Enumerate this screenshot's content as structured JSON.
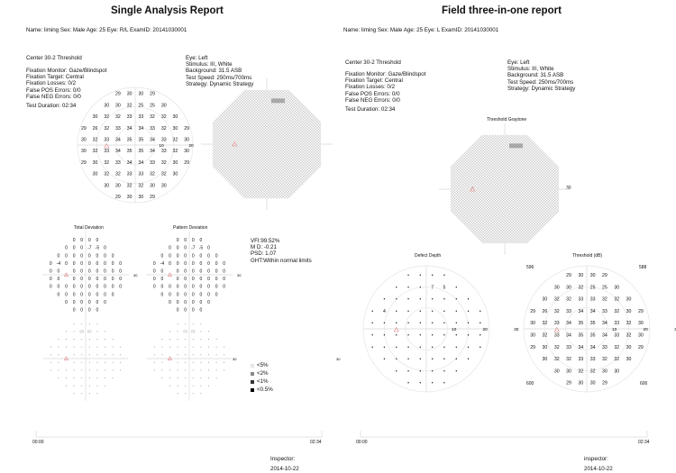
{
  "left": {
    "title": "Single Analysis Report",
    "patient": "Name: liming  Sex: Male  Age: 25  Eye: R/L  ExamID: 20141030001",
    "test_name": "Center 30-2 Threshold",
    "fixation": [
      "Fixation Monitor: Gaze/Blindspot",
      "Fixation Target: Central",
      "Fixation Losses: 0/2",
      "False POS Errors: 0/0",
      "False NEG Errors: 0/0"
    ],
    "duration": "Test Duration: 02:34",
    "params": [
      "Eye: Left",
      "Stimulus: III, White",
      "Background: 31.5 ASB",
      "Test Speed: 250ms/700ms",
      "Strategy: Dynamic Strategy"
    ],
    "axis_labels": [
      "10",
      "20",
      "30"
    ],
    "graytone_axis_label": "30",
    "total_deviation_title": "Total Deviation",
    "pattern_deviation_title": "Pattern Deviation",
    "deviation_axis_label": "30",
    "stats": [
      "VFI:99.52%",
      "M D: -0.21",
      "PSD: 1.07",
      "GHT:Within normal limits"
    ],
    "legend": [
      "<5%",
      "<2%",
      "<1%",
      "<0.5%"
    ],
    "timeline_start": "00:00",
    "timeline_end": "02:34",
    "inspector": "Inspector:",
    "date": "2014-10-22"
  },
  "right": {
    "title": "Field three-in-one report",
    "patient": "Name: liming  Sex: Male  Age: 25  Eye: L  ExamID: 20141030001",
    "test_name": "Center 30-2 Threshold",
    "fixation": [
      "Fixation Monitor: Gaze/Blindspot",
      "Fixation Target: Central",
      "Fixation Losses: 0/2",
      "False POS Errors: 0/0",
      "False NEG Errors: 0/0"
    ],
    "duration": "Test Duration: 02:34",
    "params": [
      "Eye: Left",
      "Stimulus: III, White",
      "Background: 31.5 ASB",
      "Test Speed: 250ms/700ms",
      "Strategy: Dynamic Strategy"
    ],
    "graytone_title": "Threshold Graytone",
    "graytone_axis_label": "30",
    "defect_depth_title": "Defect Depth",
    "threshold_title": "Threshold (dB)",
    "axis_labels": [
      "10",
      "20",
      "30"
    ],
    "corner_labels": [
      "596",
      "588",
      "600",
      "600"
    ],
    "timeline_start": "00:00",
    "timeline_end": "02:34",
    "inspector": "inspector:",
    "date": "2014-10-22"
  },
  "threshold_values": [
    [
      "29",
      "30",
      "30",
      "29"
    ],
    [
      "30",
      "30",
      "32",
      "25",
      "25",
      "30"
    ],
    [
      "30",
      "32",
      "32",
      "33",
      "33",
      "32",
      "32",
      "30"
    ],
    [
      "29",
      "26",
      "32",
      "33",
      "34",
      "34",
      "33",
      "32",
      "30",
      "29"
    ],
    [
      "30",
      "32",
      "33",
      "34",
      "35",
      "35",
      "34",
      "33",
      "32",
      "30"
    ],
    [
      "30",
      "32",
      "33",
      "34",
      "35",
      "35",
      "34",
      "33",
      "32",
      "30"
    ],
    [
      "29",
      "30",
      "32",
      "33",
      "34",
      "34",
      "33",
      "32",
      "30",
      "29"
    ],
    [
      "30",
      "32",
      "32",
      "33",
      "33",
      "32",
      "32",
      "30"
    ],
    [
      "30",
      "30",
      "32",
      "32",
      "30",
      "30"
    ],
    [
      "29",
      "30",
      "30",
      "29"
    ]
  ],
  "total_deviation": [
    [
      "0",
      "0",
      "0",
      "0"
    ],
    [
      "0",
      "0",
      "0",
      "-7",
      "-5",
      "0"
    ],
    [
      "0",
      "0",
      "0",
      "0",
      "0",
      "0",
      "0",
      "0"
    ],
    [
      "0",
      "-4",
      "0",
      "0",
      "0",
      "0",
      "0",
      "0",
      "0",
      "0"
    ],
    [
      "0",
      "0",
      "",
      "0",
      "0",
      "0",
      "0",
      "0",
      "0",
      "0"
    ],
    [
      "0",
      "0",
      "",
      "0",
      "0",
      "0",
      "0",
      "0",
      "0",
      "0"
    ],
    [
      "0",
      "0",
      "0",
      "0",
      "0",
      "0",
      "0",
      "0",
      "0",
      "0"
    ],
    [
      "0",
      "0",
      "0",
      "0",
      "0",
      "0",
      "0",
      "0"
    ],
    [
      "0",
      "0",
      "0",
      "0",
      "0",
      "0"
    ],
    [
      "0",
      "0",
      "0",
      "0"
    ]
  ],
  "pattern_deviation": [
    [
      "0",
      "0",
      "0",
      "0"
    ],
    [
      "0",
      "0",
      "0",
      "-7",
      "-5",
      "0"
    ],
    [
      "0",
      "0",
      "0",
      "0",
      "0",
      "0",
      "0",
      "0"
    ],
    [
      "0",
      "-4",
      "0",
      "0",
      "0",
      "0",
      "0",
      "0",
      "0",
      "0"
    ],
    [
      "0",
      "0",
      "",
      "0",
      "0",
      "0",
      "0",
      "0",
      "0",
      "0"
    ],
    [
      "0",
      "0",
      "",
      "0",
      "0",
      "0",
      "0",
      "0",
      "0",
      "0"
    ],
    [
      "0",
      "0",
      "0",
      "0",
      "0",
      "0",
      "0",
      "0",
      "0",
      "0"
    ],
    [
      "0",
      "0",
      "0",
      "0",
      "0",
      "0",
      "0",
      "0"
    ],
    [
      "0",
      "0",
      "0",
      "0",
      "0",
      "0"
    ],
    [
      "0",
      "0",
      "0",
      "0"
    ]
  ],
  "defect_depth": [
    [
      "•",
      "•",
      "•",
      "•"
    ],
    [
      "•",
      "•",
      "•",
      "7",
      "5",
      "•"
    ],
    [
      "•",
      "•",
      "•",
      "•",
      "•",
      "•",
      "•",
      "•"
    ],
    [
      "•",
      "4",
      "•",
      "•",
      "•",
      "•",
      "•",
      "•",
      "•",
      "•"
    ],
    [
      "•",
      "•",
      "•",
      "•",
      "•",
      "•",
      "•",
      "•",
      "•",
      "•"
    ],
    [
      "•",
      "•",
      "•",
      "•",
      "•",
      "•",
      "•",
      "•",
      "•",
      "•"
    ],
    [
      "•",
      "•",
      "•",
      "•",
      "•",
      "•",
      "•",
      "•",
      "•",
      "•"
    ],
    [
      "•",
      "•",
      "•",
      "•",
      "•",
      "•",
      "•",
      "•"
    ],
    [
      "•",
      "•",
      "•",
      "•",
      "•",
      "•"
    ],
    [
      "•",
      "•",
      "•",
      "•"
    ]
  ],
  "colors": {
    "blindspot": "#e08080",
    "grid": "#d8d8d8",
    "graytone": "#cfcfcf",
    "text": "#111111"
  }
}
